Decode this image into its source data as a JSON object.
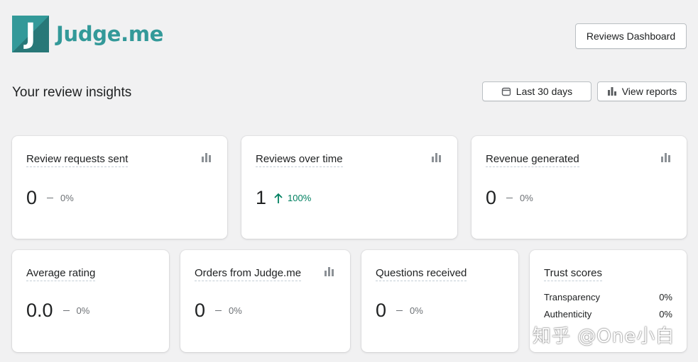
{
  "app": {
    "logo_letter": "J",
    "name": "Judge.me"
  },
  "header": {
    "dashboard_button": "Reviews Dashboard"
  },
  "insights": {
    "title": "Your review insights",
    "date_range": "Last 30 days",
    "view_reports": "View reports"
  },
  "cards": {
    "requests": {
      "title": "Review requests sent",
      "value": "0",
      "change": "0%"
    },
    "reviews": {
      "title": "Reviews over time",
      "value": "1",
      "change": "100%"
    },
    "revenue": {
      "title": "Revenue generated",
      "value": "0",
      "change": "0%"
    },
    "rating": {
      "title": "Average rating",
      "value": "0.0",
      "change": "0%"
    },
    "orders": {
      "title": "Orders from Judge.me",
      "value": "0",
      "change": "0%"
    },
    "questions": {
      "title": "Questions received",
      "value": "0",
      "change": "0%"
    },
    "trust": {
      "title": "Trust scores",
      "rows": [
        {
          "label": "Transparency",
          "value": "0%"
        },
        {
          "label": "Authenticity",
          "value": "0%"
        }
      ]
    }
  },
  "watermark": "知乎 @One小白",
  "colors": {
    "brand": "#339999",
    "positive": "#008060",
    "muted": "#6d7175"
  }
}
